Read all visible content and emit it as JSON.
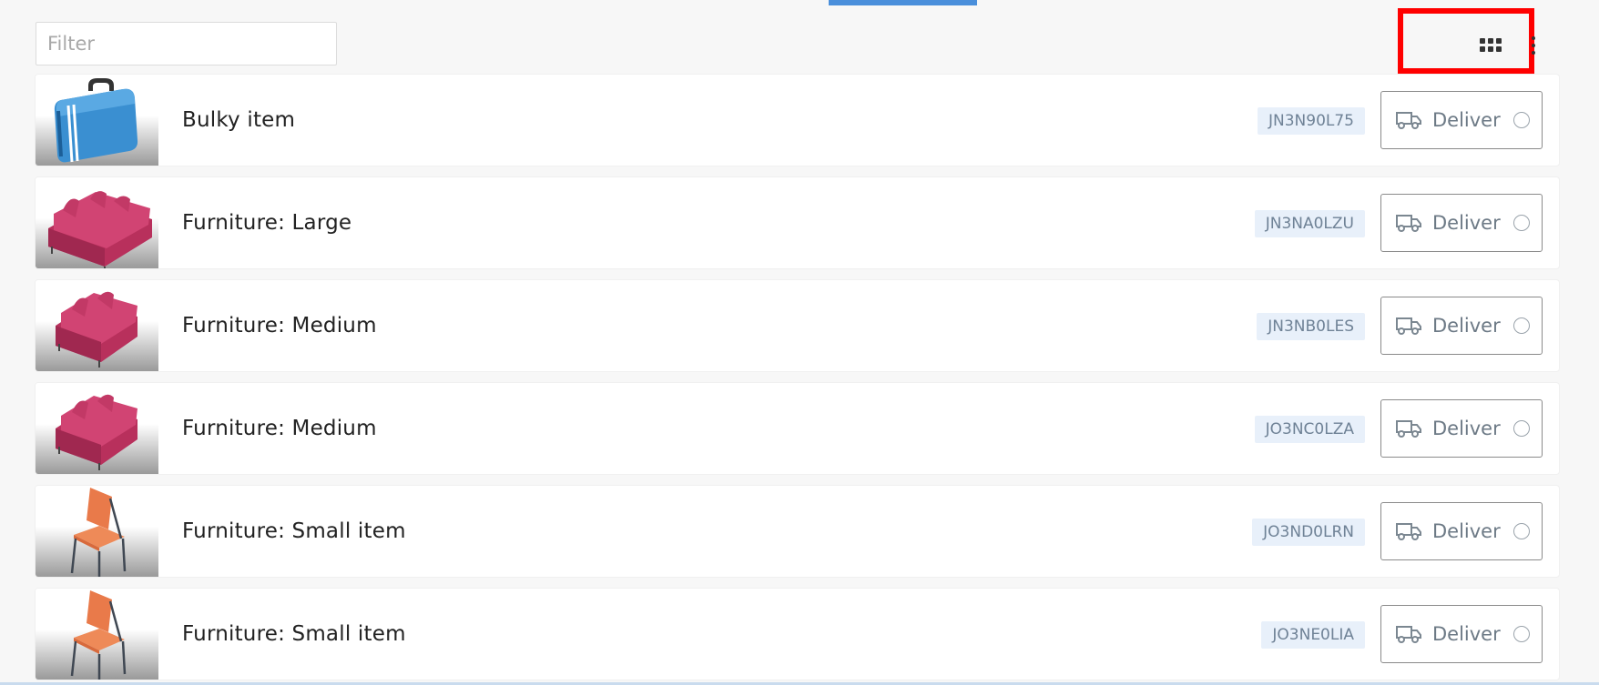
{
  "filter": {
    "placeholder": "Filter",
    "value": ""
  },
  "toolbar": {
    "view_icon": "grid-view-icon",
    "more_icon": "more-vertical-icon",
    "highlight_color": "#ff0000"
  },
  "accent_color": "#4a8fdb",
  "items": [
    {
      "title": "Bulky item",
      "code": "JN3N90L75",
      "action": "Deliver",
      "image": "suitcase"
    },
    {
      "title": "Furniture: Large",
      "code": "JN3NA0LZU",
      "action": "Deliver",
      "image": "sofa-large"
    },
    {
      "title": "Furniture: Medium",
      "code": "JN3NB0LES",
      "action": "Deliver",
      "image": "sofa-medium"
    },
    {
      "title": "Furniture: Medium",
      "code": "JO3NC0LZA",
      "action": "Deliver",
      "image": "sofa-medium"
    },
    {
      "title": "Furniture: Small item",
      "code": "JO3ND0LRN",
      "action": "Deliver",
      "image": "chair"
    },
    {
      "title": "Furniture: Small item",
      "code": "JO3NE0LIA",
      "action": "Deliver",
      "image": "chair"
    }
  ]
}
